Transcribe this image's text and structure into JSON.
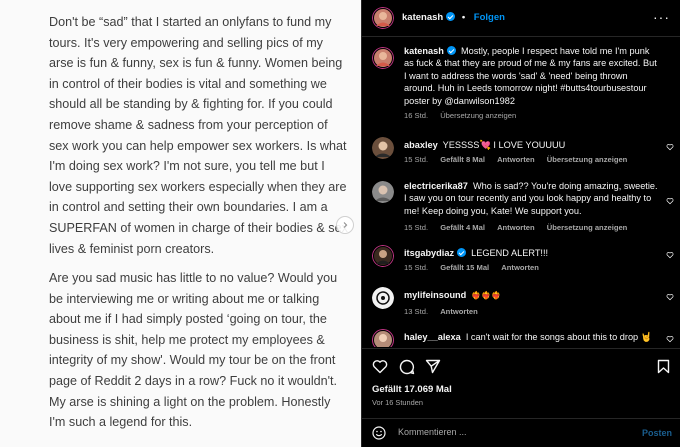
{
  "image_text": {
    "paragraph1": "Don't be “sad” that I started an onlyfans to fund my tours. It's very empowering and selling pics of my arse is fun & funny, sex is fun & funny. Women being in control of their bodies is vital and something we should all be standing by & fighting for. If you could remove shame & sadness from your perception of sex work you can help empower sex workers. Is what I'm doing sex work? I'm not sure, you tell me but I love supporting sex workers especially when they are in control and setting their own boundaries. I am a SUPERFAN of women in charge of their bodies & sex lives & feminist porn creators.",
    "paragraph2": "Are you sad music has little to no value? Would you be interviewing me or writing about me or talking about me if I had simply posted ‘going on tour, the business is shit, help me protect my employees & integrity of my show'. Would my tour be on the front page of Reddit 2 days in a row? Fuck no it wouldn't. My arse is shining a light on the problem. Honestly I'm such a legend for this."
  },
  "header": {
    "username": "katenash",
    "follow_label": "Folgen",
    "more_icon": "more-dots-icon"
  },
  "caption": {
    "username": "katenash",
    "text": "Mostly, people I respect have told me I'm punk as fuck & that they are proud of me & my fans are excited. But I want to address the words 'sad' & 'need' being thrown around. Huh in Leeds tomorrow night! #butts4tourbusestour poster by @danwilson1982",
    "time": "16 Std.",
    "translate": "Übersetzung anzeigen"
  },
  "comments": [
    {
      "username": "abaxley",
      "text": "YESSSS💘 I LOVE YOUUUU",
      "time": "15 Std.",
      "likes": "Gefällt 8 Mal",
      "reply": "Antworten",
      "translate": "Übersetzung anzeigen"
    },
    {
      "username": "electricerika87",
      "text": "Who is sad?? You're doing amazing, sweetie. I saw you on tour recently and you look happy and healthy to me! Keep doing you, Kate! We support you.",
      "time": "15 Std.",
      "likes": "Gefällt 4 Mal",
      "reply": "Antworten",
      "translate": "Übersetzung anzeigen"
    },
    {
      "username": "itsgabydiaz",
      "text": "LEGEND ALERT!!!",
      "time": "15 Std.",
      "likes": "Gefällt 15 Mal",
      "reply": "Antworten"
    },
    {
      "username": "mylifeinsound",
      "text": "❤️‍🔥❤️‍🔥❤️‍🔥",
      "time": "13 Std.",
      "reply": "Antworten"
    },
    {
      "username": "haley__alexa",
      "text": "I can't wait for the songs about this to drop 🤘"
    }
  ],
  "footer": {
    "likes": "Gefällt 17.069 Mal",
    "ago": "Vor 16 Stunden",
    "comment_placeholder": "Kommentieren ...",
    "post_label": "Posten"
  },
  "colors": {
    "accent": "#0095f6",
    "background": "#000000",
    "secondary_text": "#a8a8a8"
  }
}
